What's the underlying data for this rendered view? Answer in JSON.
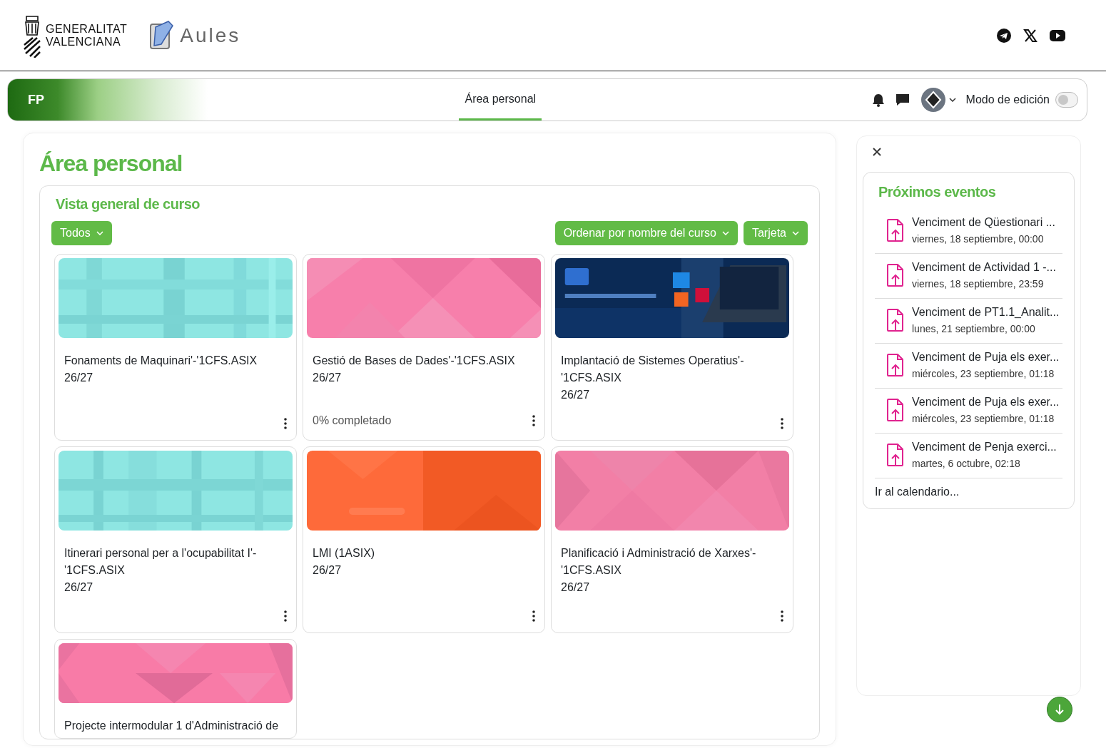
{
  "header": {
    "brand_line1": "GENERALITAT",
    "brand_line2": "VALENCIANA",
    "app_name": "Aules"
  },
  "navbar": {
    "site": "FP",
    "tabs": [
      {
        "label": "Área personal",
        "selected": true
      }
    ],
    "edit_mode": {
      "label": "Modo de edición",
      "on": false
    }
  },
  "page_title": "Área personal",
  "course_overview": {
    "title": "Vista general de curso",
    "filter": "Todos",
    "sort": "Ordenar por nombre del curso",
    "view": "Tarjeta",
    "courses": [
      {
        "title": "Fonaments de Maquinari'-'1CFS.ASIX",
        "period": "26/27"
      },
      {
        "title": "Gestió de Bases de Dades'-'1CFS.ASIX",
        "period": "26/27",
        "progress": "0% completado"
      },
      {
        "title": "Implantació de Sistemes Operatius'-'1CFS.ASIX",
        "period": "26/27"
      },
      {
        "title": "Itinerari personal per a l'ocupabilitat I'-'1CFS.ASIX",
        "period": "26/27"
      },
      {
        "title": "LMI (1ASIX)",
        "period": "26/27"
      },
      {
        "title": "Planificació i Administració de Xarxes'-'1CFS.ASIX",
        "period": "26/27"
      },
      {
        "title": "Projecte intermodular 1 d'Administració de"
      }
    ]
  },
  "upcoming_events": {
    "title": "Próximos eventos",
    "events": [
      {
        "name": "Venciment de Qüestionari ...",
        "date": "viernes, 18 septiembre, 00:00"
      },
      {
        "name": "Venciment de Actividad 1 -...",
        "date": "viernes, 18 septiembre, 23:59"
      },
      {
        "name": "Venciment de PT1.1_Analit...",
        "date": "lunes, 21 septiembre, 00:00"
      },
      {
        "name": "Venciment de Puja els exer...",
        "date": "miércoles, 23 septiembre, 01:18"
      },
      {
        "name": "Venciment de Puja els exer...",
        "date": "miércoles, 23 septiembre, 01:18"
      },
      {
        "name": "Venciment de Penja exerci...",
        "date": "martes, 6 octubre, 02:18"
      }
    ],
    "calendar_link": "Ir al calendario..."
  }
}
